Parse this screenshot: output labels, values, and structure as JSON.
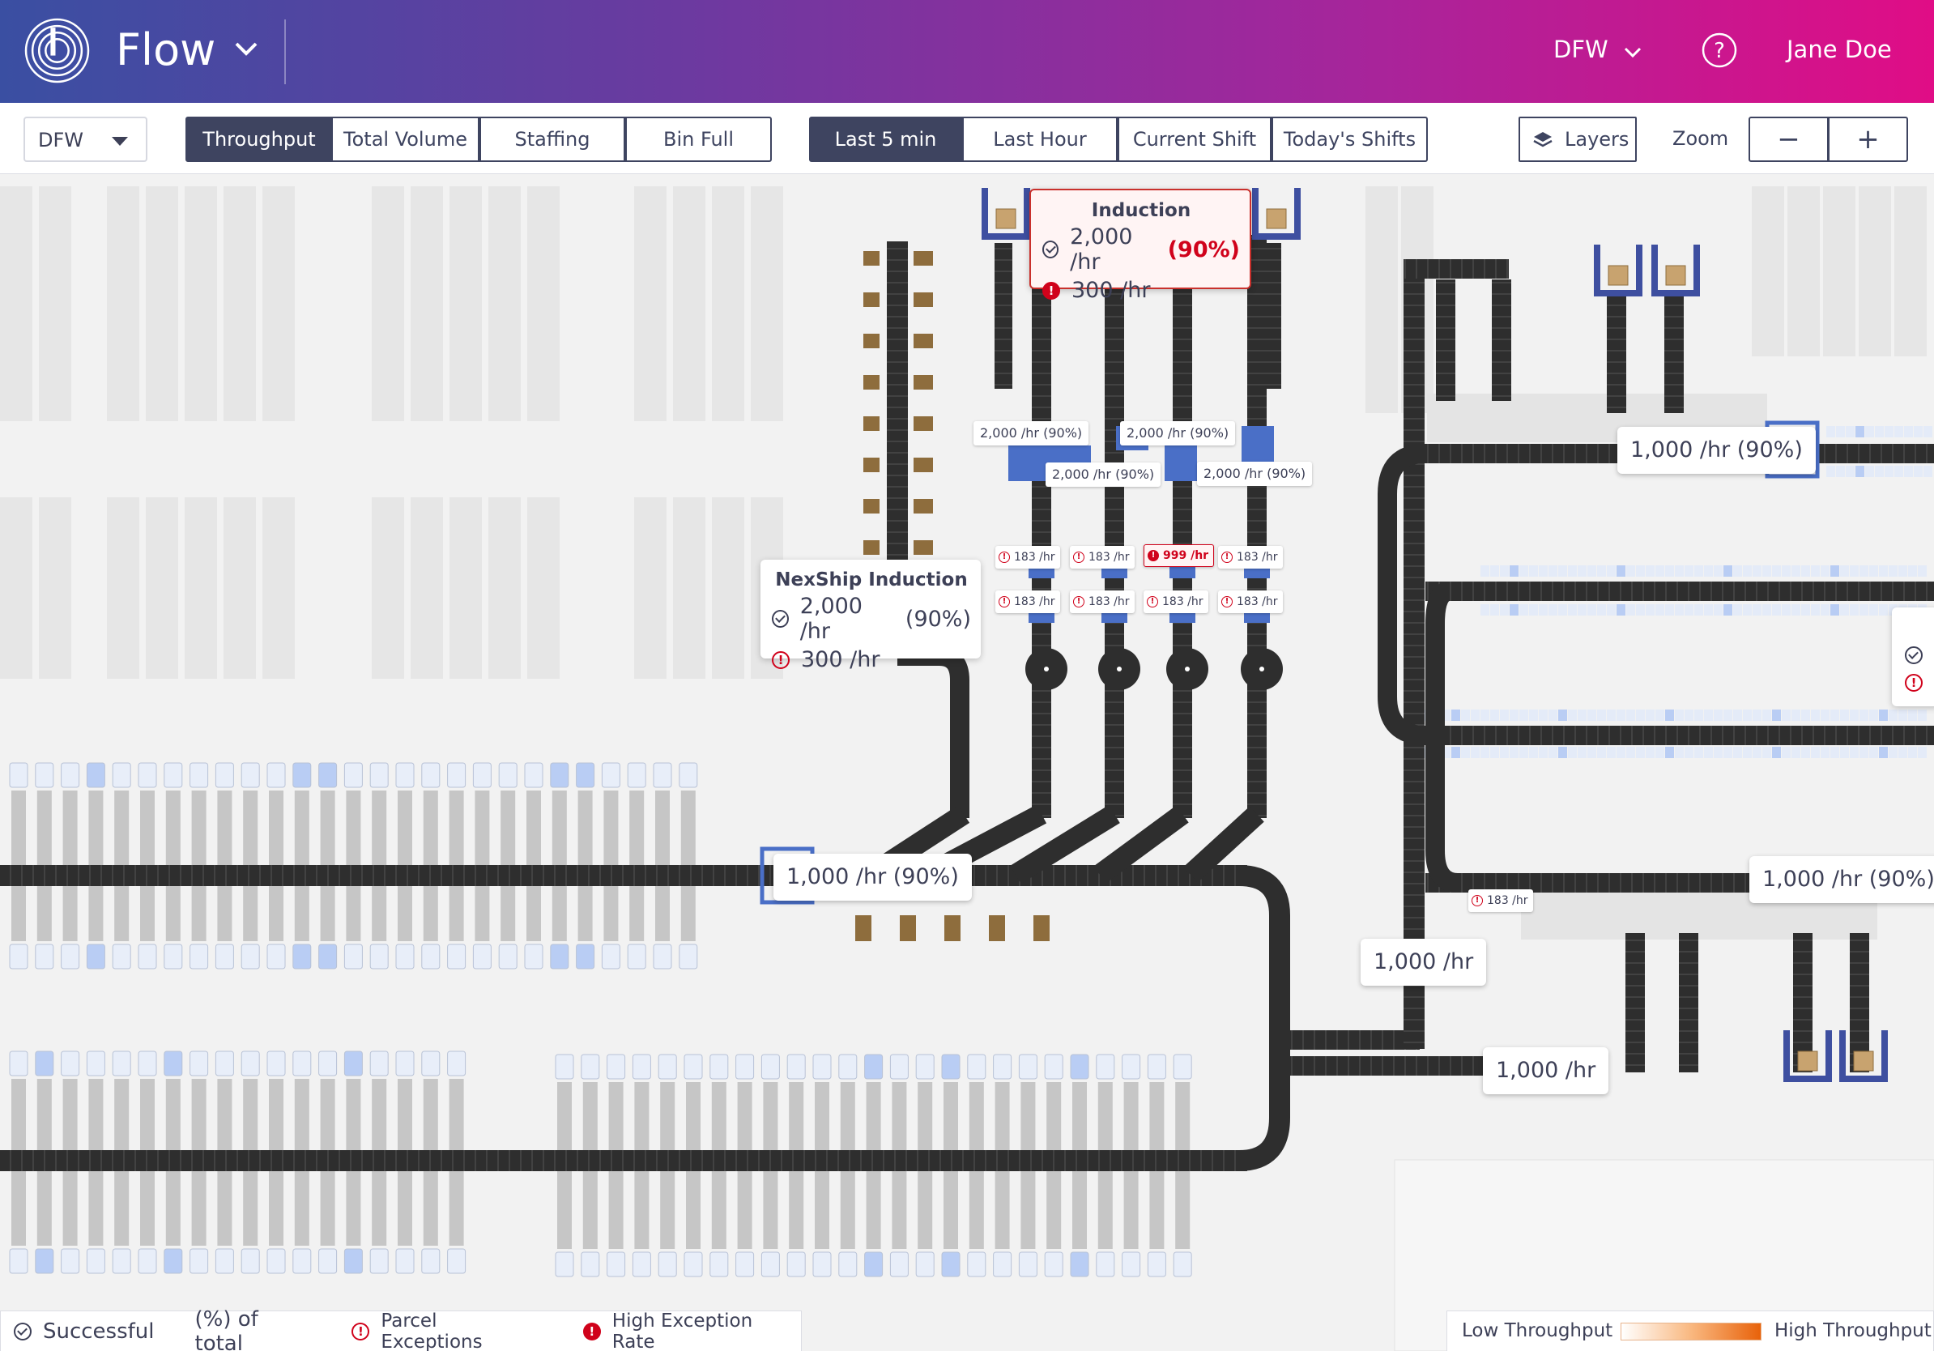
{
  "header": {
    "app_title": "Flow",
    "site": "DFW",
    "user": "Jane Doe"
  },
  "toolbar": {
    "site_select": "DFW",
    "metric_tabs": [
      "Throughput",
      "Total Volume",
      "Staffing",
      "Bin Full"
    ],
    "metric_active": "Throughput",
    "time_tabs": [
      "Last 5 min",
      "Last Hour",
      "Current Shift",
      "Today's Shifts"
    ],
    "time_active": "Last 5 min",
    "layers_label": "Layers",
    "zoom_label": "Zoom",
    "zoom_out": "−",
    "zoom_in": "+"
  },
  "induction_card": {
    "title": "Induction",
    "success": "2,000 /hr",
    "pct": "(90%)",
    "exceptions": "300 /hr"
  },
  "nexship_card": {
    "title": "NexShip Induction",
    "success": "2,000 /hr",
    "pct": "(90%)",
    "exceptions": "300 /hr"
  },
  "lane_rates": [
    "2,000 /hr  (90%)",
    "2,000 /hr  (90%)",
    "2,000 /hr  (90%)",
    "2,000 /hr  (90%)"
  ],
  "lane_exceptions_top": [
    "183 /hr",
    "183 /hr",
    "999 /hr",
    "183 /hr"
  ],
  "lane_exceptions_bottom": [
    "183 /hr",
    "183 /hr",
    "183 /hr",
    "183 /hr"
  ],
  "conveyor_rates": {
    "main_left": "1,000 /hr  (90%)",
    "upper_right": "1,000 /hr  (90%)",
    "lower_right": "1,000 /hr  (90%)",
    "mid_vertical": "1,000 /hr",
    "bottom_link": "1,000 /hr",
    "small_exception": "183 /hr"
  },
  "legend": {
    "successful": "Successful",
    "pct_total": "(%) of total",
    "parcel_exceptions": "Parcel Exceptions",
    "high_exception_rate": "High Exception Rate",
    "low_throughput": "Low Throughput",
    "high_throughput": "High Throughput"
  },
  "colors": {
    "header_start": "#3a4fa2",
    "header_end": "#e00d86",
    "conveyor": "#2e2e2e",
    "station": "#4a6fc7",
    "exception": "#d0021b",
    "brown": "#8e6d3d"
  }
}
